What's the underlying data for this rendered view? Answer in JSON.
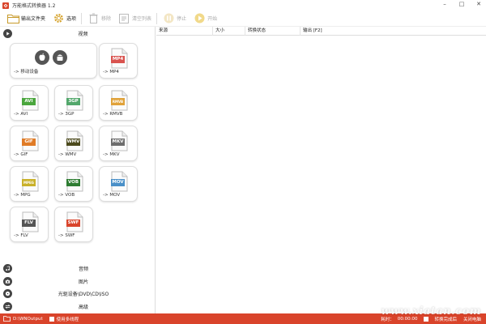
{
  "window": {
    "title": "万能格式转换器 1.2",
    "controls": [
      "–",
      "□",
      "✕"
    ]
  },
  "toolbar": {
    "output_folder": "输出文件夹",
    "options": "选项",
    "remove": "移除",
    "clear_list": "清空列表",
    "stop": "停止",
    "start": "开始"
  },
  "left": {
    "video_section": "视频",
    "tiles": [
      {
        "label": "-> 移动设备",
        "badge": "",
        "color": "#666666"
      },
      {
        "label": "-> MP4",
        "badge": "MP4",
        "color": "#d9534f"
      },
      {
        "label": "-> AVI",
        "badge": "AVI",
        "color": "#4aa63d"
      },
      {
        "label": "-> 3GP",
        "badge": "3GP",
        "color": "#52a76b"
      },
      {
        "label": "-> RMVB",
        "badge": "RMVB",
        "color": "#e0a23a"
      },
      {
        "label": "-> GIF",
        "badge": "GIF",
        "color": "#e07b26"
      },
      {
        "label": "-> WMV",
        "badge": "WMV",
        "color": "#4c4a1d"
      },
      {
        "label": "-> MKV",
        "badge": "MKV",
        "color": "#6e6e6e"
      },
      {
        "label": "-> MPG",
        "badge": "MPEG",
        "color": "#c9b12a"
      },
      {
        "label": "-> VOB",
        "badge": "VOB",
        "color": "#2e7d32"
      },
      {
        "label": "-> MOV",
        "badge": "MOV",
        "color": "#4a90c8"
      },
      {
        "label": "-> FLV",
        "badge": "FLV",
        "color": "#555555"
      },
      {
        "label": "-> SWF",
        "badge": "SWF",
        "color": "#d9442b"
      }
    ],
    "sections": [
      {
        "label": "音频"
      },
      {
        "label": "图片"
      },
      {
        "label": "光驱设备\\DVD\\CD\\ISO"
      },
      {
        "label": "高级"
      }
    ]
  },
  "list": {
    "columns": [
      "来源",
      "大小",
      "转换状态",
      "输出 [F2]"
    ]
  },
  "status": {
    "path": "D:\\WNOutput",
    "multithread": "使用多线程",
    "elapsed_label": "耗时：",
    "elapsed": "00:00:00",
    "after_done": "转换完成后",
    "shutdown": "关闭电脑"
  },
  "watermark": "www.xiatan.com",
  "colors": {
    "accent": "#d9442b",
    "dark_icon": "#444444"
  }
}
